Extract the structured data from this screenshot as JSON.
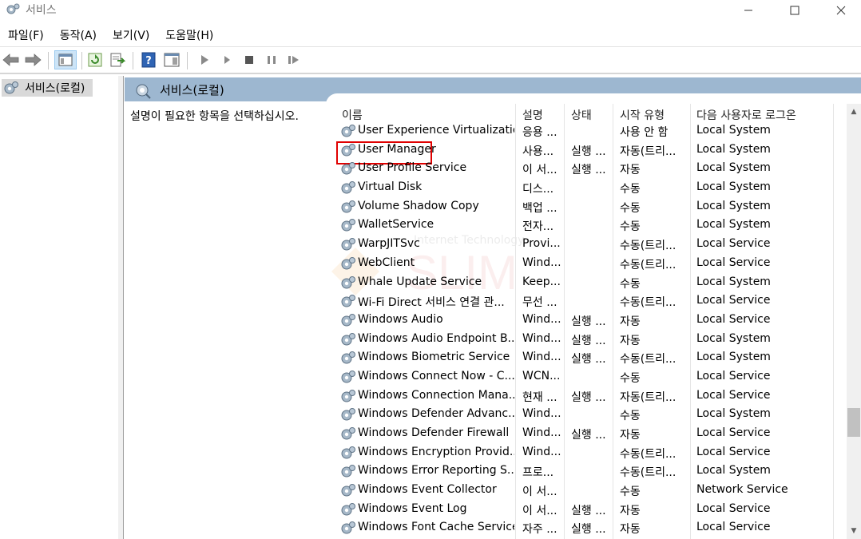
{
  "window": {
    "title": "서비스",
    "title_icon": "gear-icon"
  },
  "menu": [
    "파일(F)",
    "동작(A)",
    "보기(V)",
    "도움말(H)"
  ],
  "toolbar": {
    "buttons": [
      "back-arrow-icon",
      "forward-arrow-icon",
      "console-tree-icon",
      "refresh-icon",
      "export-list-icon",
      "help-icon",
      "properties-pane-icon",
      "start-service-icon",
      "start-service-alt-icon",
      "stop-service-icon",
      "pause-service-icon",
      "resume-service-icon"
    ]
  },
  "tree": {
    "selected_label": "서비스(로컬)"
  },
  "pane": {
    "header_title": "서비스(로컬)",
    "description_prompt": "설명이 필요한 항목을 선택하십시오."
  },
  "columns": {
    "name": "이름",
    "description": "설명",
    "status": "상태",
    "startup_type": "시작 유형",
    "logon_as": "다음 사용자로 로그온"
  },
  "services": [
    {
      "name": "User Experience Virtualizatio...",
      "desc": "응용 ...",
      "status": "",
      "start": "사용 안 함",
      "logon": "Local System"
    },
    {
      "name": "User Manager",
      "desc": "사용...",
      "status": "실행 ...",
      "start": "자동(트리...",
      "logon": "Local System"
    },
    {
      "name": "User Profile Service",
      "desc": "이 서...",
      "status": "실행 ...",
      "start": "자동",
      "logon": "Local System"
    },
    {
      "name": "Virtual Disk",
      "desc": "디스...",
      "status": "",
      "start": "수동",
      "logon": "Local System"
    },
    {
      "name": "Volume Shadow Copy",
      "desc": "백업 ...",
      "status": "",
      "start": "수동",
      "logon": "Local System"
    },
    {
      "name": "WalletService",
      "desc": "전자...",
      "status": "",
      "start": "수동",
      "logon": "Local System"
    },
    {
      "name": "WarpJITSvc",
      "desc": "Provi...",
      "status": "",
      "start": "수동(트리...",
      "logon": "Local Service"
    },
    {
      "name": "WebClient",
      "desc": "Wind...",
      "status": "",
      "start": "수동(트리...",
      "logon": "Local Service"
    },
    {
      "name": "Whale Update Service",
      "desc": "Keep...",
      "status": "",
      "start": "수동",
      "logon": "Local System"
    },
    {
      "name": "Wi-Fi Direct 서비스 연결 관...",
      "desc": "무선 ...",
      "status": "",
      "start": "수동(트리...",
      "logon": "Local Service"
    },
    {
      "name": "Windows Audio",
      "desc": "Wind...",
      "status": "실행 ...",
      "start": "자동",
      "logon": "Local Service"
    },
    {
      "name": "Windows Audio Endpoint B...",
      "desc": "Wind...",
      "status": "실행 ...",
      "start": "자동",
      "logon": "Local System"
    },
    {
      "name": "Windows Biometric Service",
      "desc": "Wind...",
      "status": "실행 ...",
      "start": "수동(트리...",
      "logon": "Local System"
    },
    {
      "name": "Windows Connect Now - C...",
      "desc": "WCN...",
      "status": "",
      "start": "수동",
      "logon": "Local Service"
    },
    {
      "name": "Windows Connection Mana...",
      "desc": "현재 ...",
      "status": "실행 ...",
      "start": "자동(트리...",
      "logon": "Local Service"
    },
    {
      "name": "Windows Defender Advanc...",
      "desc": "Wind...",
      "status": "",
      "start": "수동",
      "logon": "Local System"
    },
    {
      "name": "Windows Defender Firewall",
      "desc": "Wind...",
      "status": "실행 ...",
      "start": "자동",
      "logon": "Local Service"
    },
    {
      "name": "Windows Encryption Provid...",
      "desc": "Wind...",
      "status": "",
      "start": "수동(트리...",
      "logon": "Local Service"
    },
    {
      "name": "Windows Error Reporting S...",
      "desc": "프로...",
      "status": "",
      "start": "수동(트리...",
      "logon": "Local System"
    },
    {
      "name": "Windows Event Collector",
      "desc": "이 서...",
      "status": "",
      "start": "수동",
      "logon": "Network Service"
    },
    {
      "name": "Windows Event Log",
      "desc": "이 서...",
      "status": "실행 ...",
      "start": "자동",
      "logon": "Local Service"
    },
    {
      "name": "Windows Font Cache Service",
      "desc": "자주 ...",
      "status": "실행 ...",
      "start": "자동",
      "logon": "Local Service"
    }
  ],
  "highlighted_service": "User Manager",
  "watermark": {
    "top_text": "Internet Technology",
    "big_text": "SLIM"
  },
  "colors": {
    "pane_header": "#9db7d0",
    "highlight": "#e00000",
    "selection": "#d9d9d9"
  }
}
